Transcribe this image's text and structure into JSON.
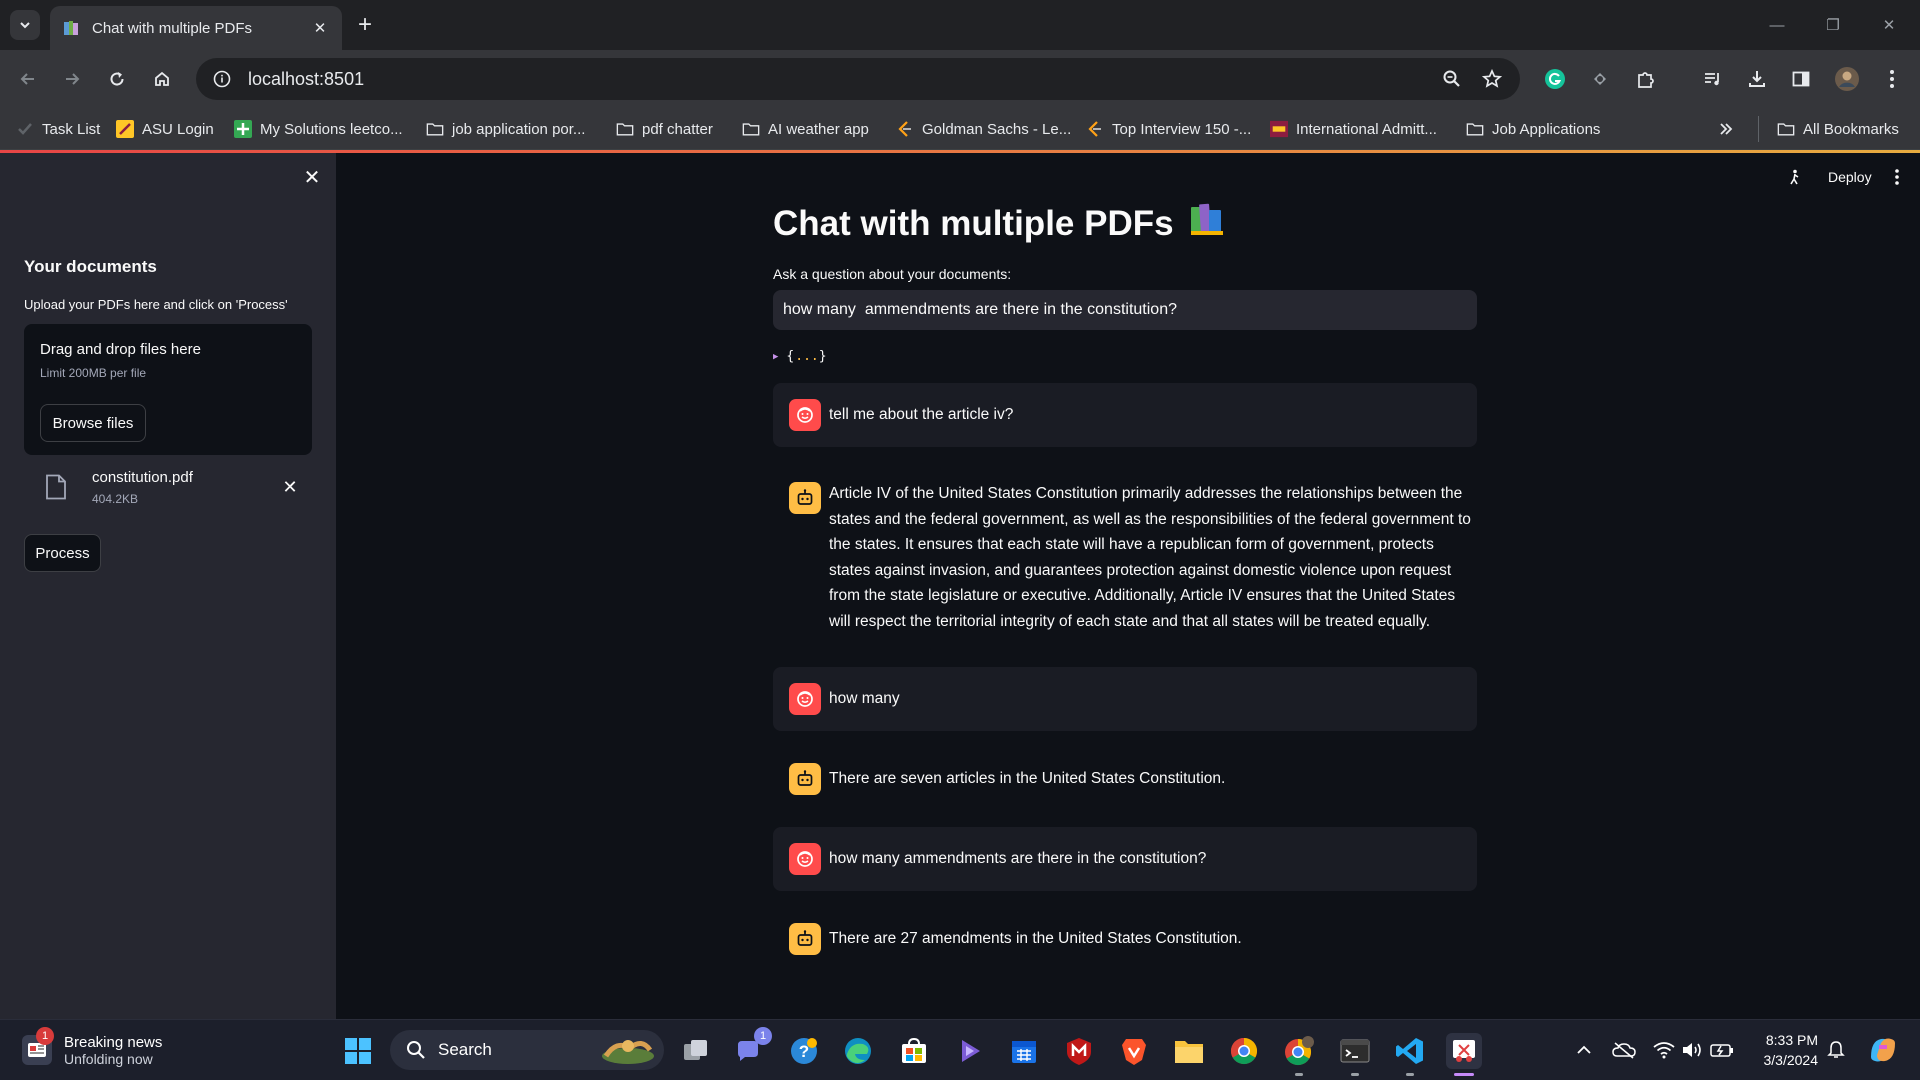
{
  "browser": {
    "tab_title": "Chat with multiple PDFs",
    "url": "localhost:8501",
    "bookmarks": [
      {
        "label": "Task List"
      },
      {
        "label": "ASU Login"
      },
      {
        "label": "My Solutions leetco..."
      },
      {
        "label": "job application por..."
      },
      {
        "label": "pdf chatter"
      },
      {
        "label": "AI weather app"
      },
      {
        "label": "Goldman Sachs - Le..."
      },
      {
        "label": "Top Interview 150 -..."
      },
      {
        "label": "International Admitt..."
      },
      {
        "label": "Job Applications"
      }
    ],
    "all_bookmarks": "All Bookmarks"
  },
  "sidebar": {
    "heading": "Your documents",
    "subtext": "Upload your PDFs here and click on 'Process'",
    "dropzone_title": "Drag and drop files here",
    "dropzone_limit": "Limit 200MB per file",
    "browse_label": "Browse files",
    "file": {
      "name": "constitution.pdf",
      "size": "404.2KB"
    },
    "process_label": "Process"
  },
  "main": {
    "deploy_label": "Deploy",
    "title": "Chat with multiple PDFs",
    "question_label": "Ask a question about your documents:",
    "question_value": "how many  ammendments are there in the constitution?",
    "json_open": "{",
    "json_dots": "...",
    "json_close": "}",
    "messages": [
      {
        "role": "user",
        "text": "tell me about the article iv?"
      },
      {
        "role": "assistant",
        "text": "Article IV of the United States Constitution primarily addresses the relationships between the states and the federal government, as well as the responsibilities of the federal government to the states. It ensures that each state will have a republican form of government, protects states against invasion, and guarantees protection against domestic violence upon request from the state legislature or executive. Additionally, Article IV ensures that the United States will respect the territorial integrity of each state and that all states will be treated equally."
      },
      {
        "role": "user",
        "text": "how many"
      },
      {
        "role": "assistant",
        "text": "There are seven articles in the United States Constitution."
      },
      {
        "role": "user",
        "text": "how many ammendments are there in the constitution?"
      },
      {
        "role": "assistant",
        "text": "There are 27 amendments in the United States Constitution."
      }
    ]
  },
  "taskbar": {
    "news_title": "Breaking news",
    "news_sub": "Unfolding now",
    "news_badge": "1",
    "search_label": "Search",
    "teams_badge": "1",
    "time": "8:33 PM",
    "date": "3/3/2024"
  },
  "colors": {
    "user_avatar": "#ff4b4b",
    "assistant_avatar": "#ffbd45",
    "background": "#0e1117",
    "sidebar": "#262730"
  }
}
